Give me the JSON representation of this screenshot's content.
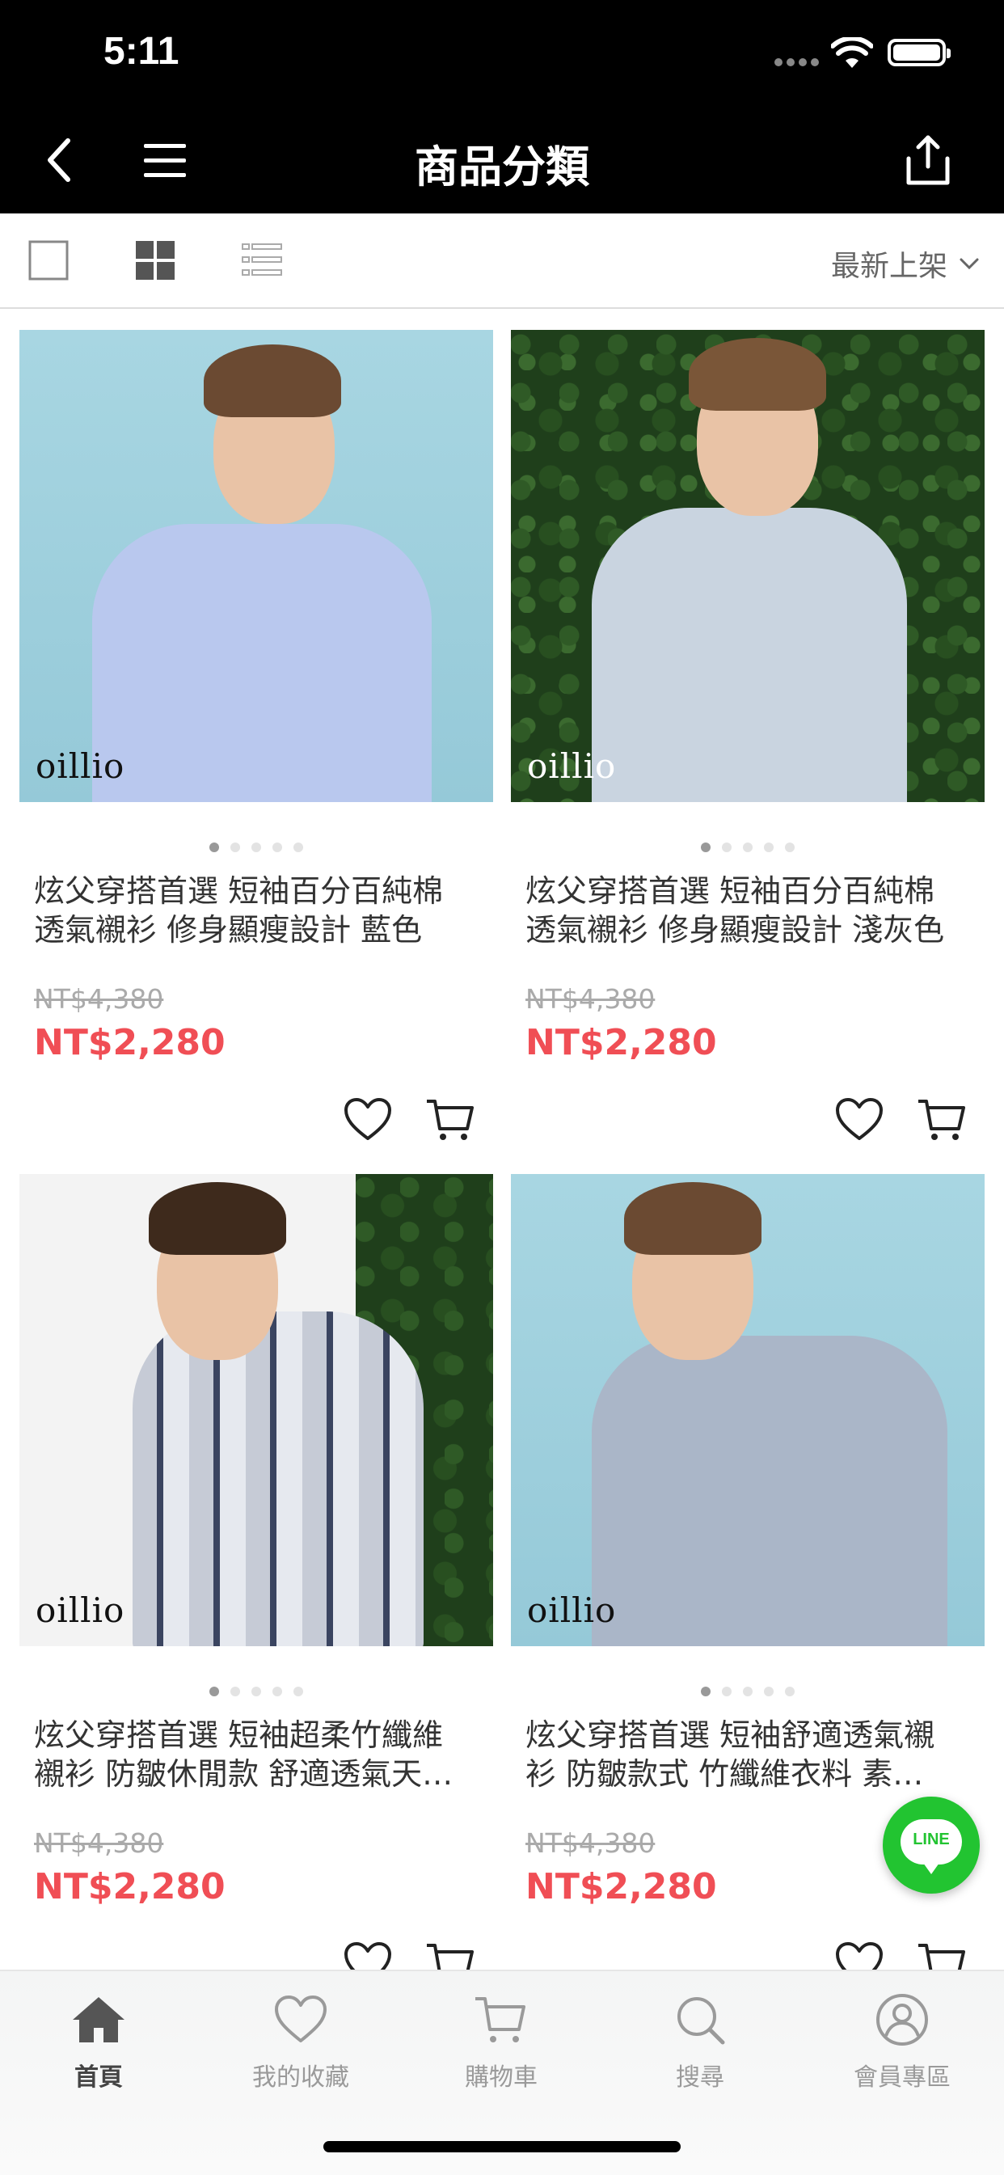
{
  "status_bar": {
    "time": "5:11"
  },
  "nav": {
    "title": "商品分類"
  },
  "toolbar": {
    "sort_label": "最新上架"
  },
  "products": [
    {
      "title_line1": "炫父穿搭首選 短袖百分百純棉",
      "title_line2": "透氣襯衫 修身顯瘦設計 藍色",
      "original_price": "NT$4,380",
      "sale_price": "NT$2,280",
      "brand": "oillio"
    },
    {
      "title_line1": "炫父穿搭首選 短袖百分百純棉",
      "title_line2": "透氣襯衫 修身顯瘦設計 淺灰色",
      "original_price": "NT$4,380",
      "sale_price": "NT$2,280",
      "brand": "oillio"
    },
    {
      "title_line1": "炫父穿搭首選 短袖超柔竹纖維",
      "title_line2": "襯衫 防皺休閒款 舒適透氣天…",
      "original_price": "NT$4,380",
      "sale_price": "NT$2,280",
      "brand": "oillio"
    },
    {
      "title_line1": "炫父穿搭首選 短袖舒適透氣襯",
      "title_line2": "衫 防皺款式 竹纖維衣料 素…",
      "original_price": "NT$4,380",
      "sale_price": "NT$2,280",
      "brand": "oillio"
    }
  ],
  "line_button": {
    "label": "LINE"
  },
  "tabs": [
    {
      "label": "首頁"
    },
    {
      "label": "我的收藏"
    },
    {
      "label": "購物車"
    },
    {
      "label": "搜尋"
    },
    {
      "label": "會員專區"
    }
  ],
  "colors": {
    "accent_price": "#f04e55",
    "line_green": "#22c431"
  }
}
